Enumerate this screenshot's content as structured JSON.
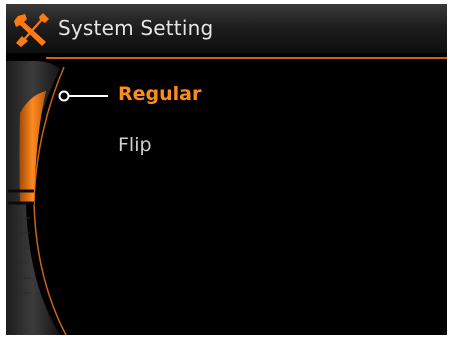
{
  "header": {
    "title": "System Setting",
    "icon": "tools-icon"
  },
  "menu": {
    "items": [
      {
        "label": "Regular",
        "selected": true
      },
      {
        "label": "Flip",
        "selected": false
      }
    ]
  },
  "colors": {
    "accent": "#ff8c1a",
    "accent_dark": "#c8641a",
    "background": "#000000",
    "text": "#cfcfcf"
  }
}
